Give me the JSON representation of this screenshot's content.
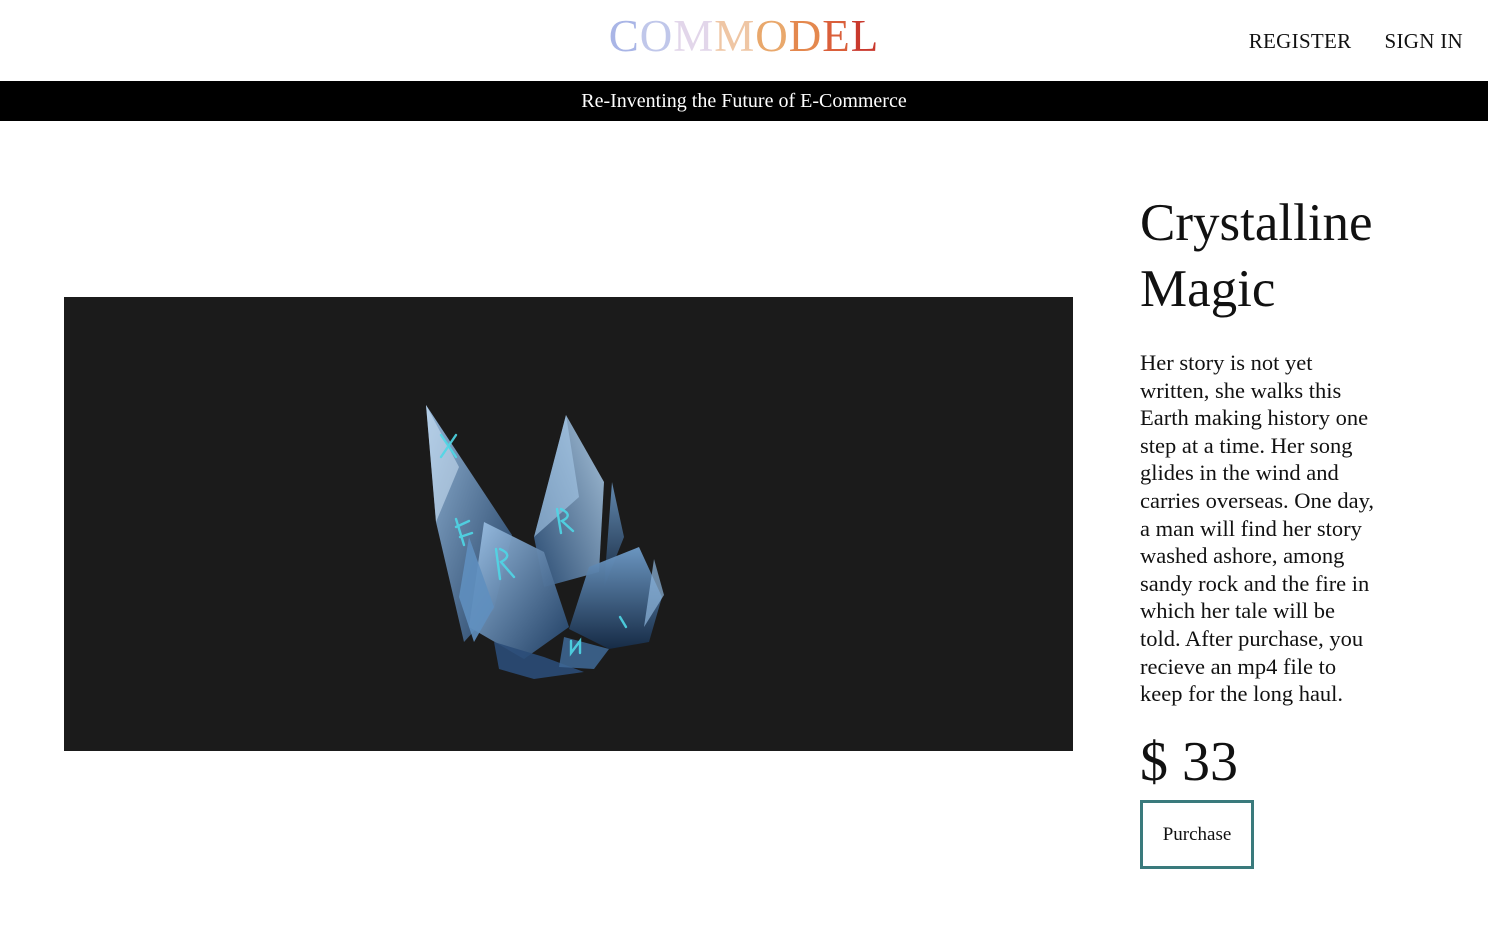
{
  "header": {
    "logo_letters": [
      {
        "char": "C",
        "color": "#a9b5e6"
      },
      {
        "char": "O",
        "color": "#c0c7ea"
      },
      {
        "char": "M",
        "color": "#e2d6ea"
      },
      {
        "char": "M",
        "color": "#efc6a4"
      },
      {
        "char": "O",
        "color": "#e9a86c"
      },
      {
        "char": "D",
        "color": "#e4884e"
      },
      {
        "char": "E",
        "color": "#da5f3a"
      },
      {
        "char": "L",
        "color": "#c9392d"
      }
    ],
    "nav": {
      "register": "REGISTER",
      "sign_in": "SIGN IN"
    }
  },
  "banner": {
    "text": "Re-Inventing the Future of E-Commerce"
  },
  "product": {
    "media_icon": "crystal-cluster-image",
    "title_line1": "Crystalline",
    "title_line2": "Magic",
    "description": "Her story is not yet written, she walks this Earth making history one step at a time. Her song glides in the wind and carries overseas. One day, a man will find her story washed ashore, among sandy rock and the fire in which her tale will be told. After purchase, you recieve an mp4 file to keep for the long haul.",
    "price": "$ 33",
    "purchase_label": "Purchase"
  },
  "colors": {
    "banner_bg": "#000000",
    "viewer_bg": "#1b1b1b",
    "button_border": "#3a7a7c"
  }
}
